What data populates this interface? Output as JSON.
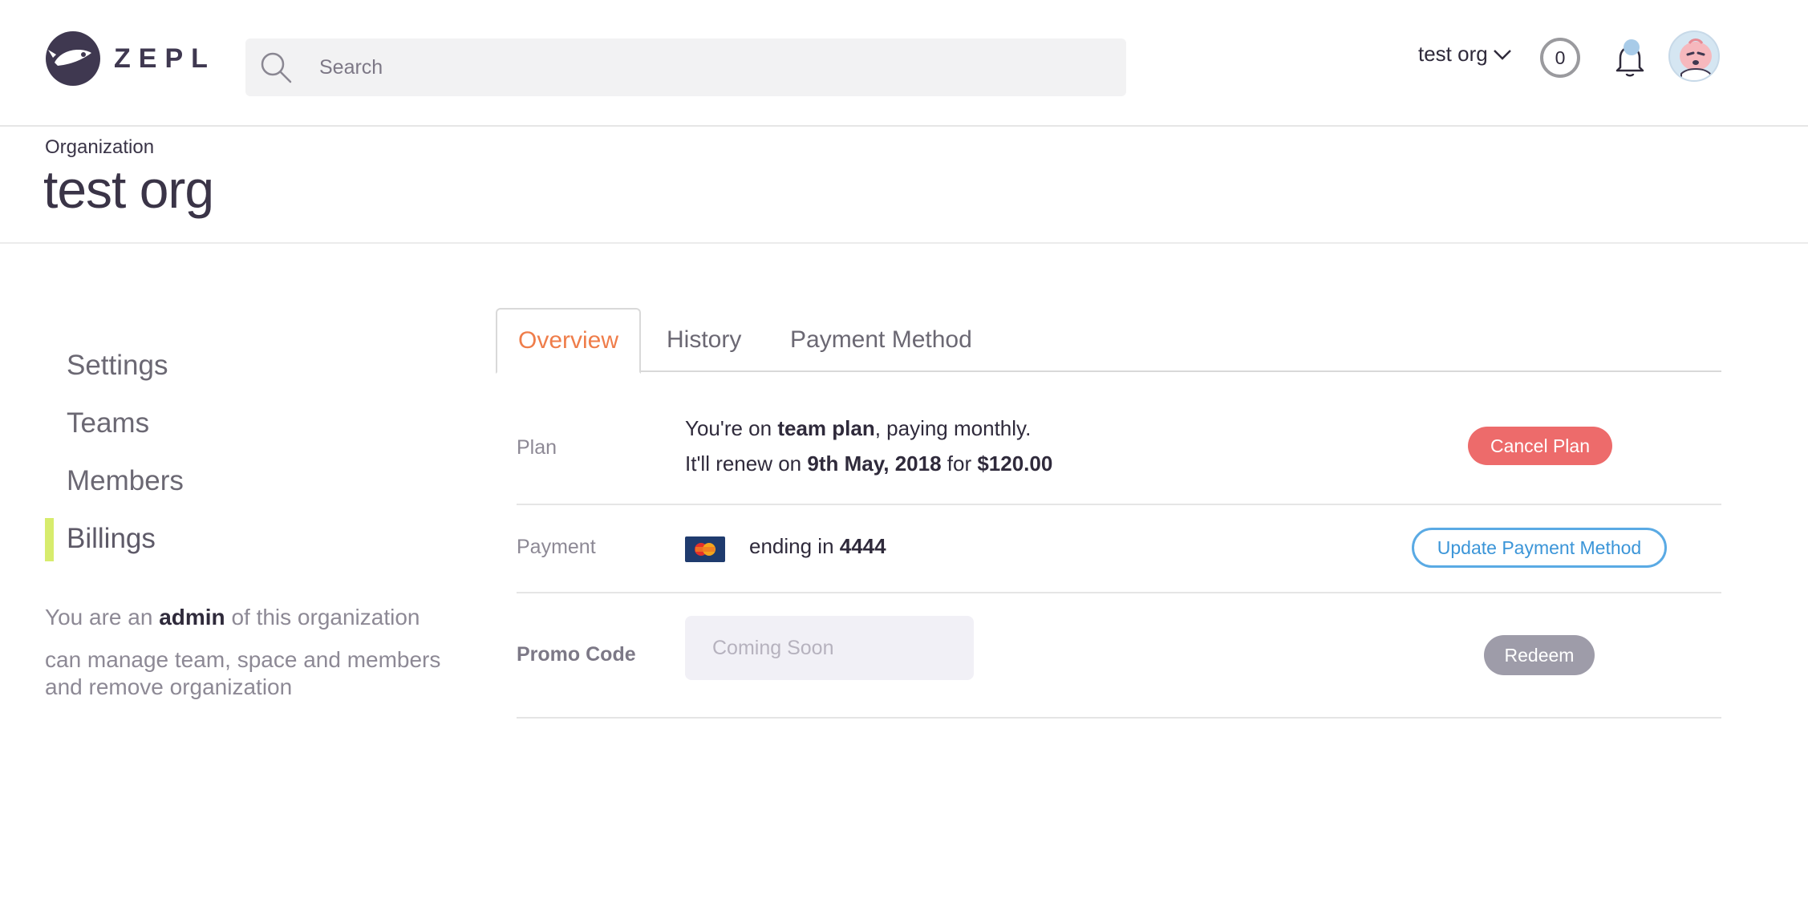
{
  "header": {
    "logo_text": "ZEPL",
    "search_placeholder": "Search",
    "org_switch_label": "test org",
    "credit_count": "0",
    "notification_unread": true
  },
  "org": {
    "eyebrow": "Organization",
    "title": "test org"
  },
  "sidebar": {
    "items": [
      {
        "label": "Settings",
        "active": false
      },
      {
        "label": "Teams",
        "active": false
      },
      {
        "label": "Members",
        "active": false
      },
      {
        "label": "Billings",
        "active": true
      }
    ],
    "role_prefix": "You are an ",
    "role": "admin",
    "role_suffix": " of this organization",
    "role_description": "can manage team, space and members and remove organization"
  },
  "tabs": [
    {
      "label": "Overview",
      "active": true
    },
    {
      "label": "History",
      "active": false
    },
    {
      "label": "Payment Method",
      "active": false
    }
  ],
  "plan": {
    "label": "Plan",
    "line1_prefix": "You're on ",
    "plan_name": "team plan",
    "line1_suffix": ", paying monthly.",
    "line2_prefix": "It'll renew on ",
    "renew_date": "9th May, 2018",
    "line2_mid": " for ",
    "amount": "$120.00",
    "cancel_label": "Cancel Plan"
  },
  "payment": {
    "label": "Payment",
    "text_prefix": "ending in ",
    "last4": "4444",
    "card_icon": "mastercard-icon",
    "update_label": "Update Payment Method"
  },
  "promo": {
    "label": "Promo Code",
    "placeholder": "Coming Soon",
    "redeem_label": "Redeem"
  },
  "colors": {
    "accent_orange": "#ef7d4a",
    "cancel_red": "#ed6b6b",
    "update_blue": "#5aaae4",
    "active_bar": "#d7ec6d",
    "redeem_gray": "#9e9ca9"
  }
}
